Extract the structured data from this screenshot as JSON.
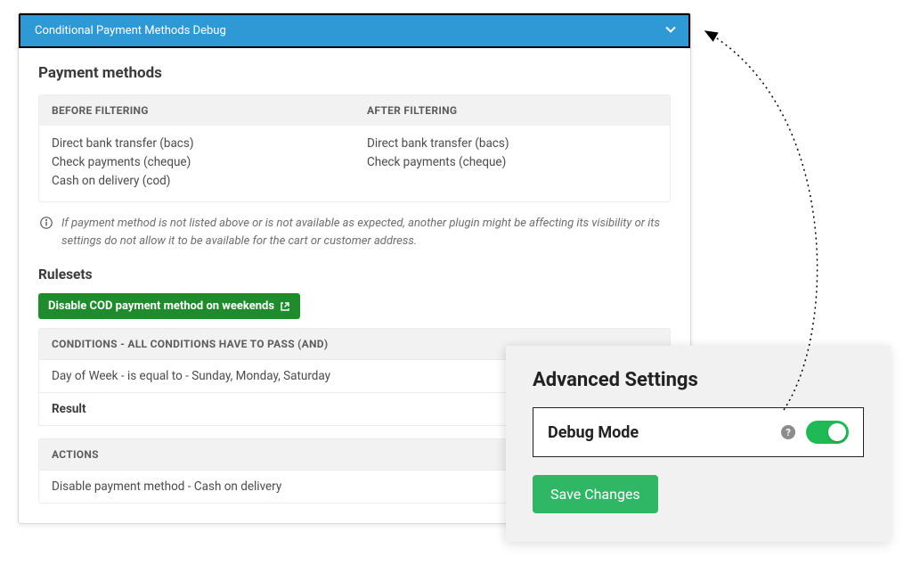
{
  "debug_header": {
    "title": "Conditional Payment Methods Debug"
  },
  "methods": {
    "heading": "Payment methods",
    "before_label": "BEFORE FILTERING",
    "after_label": "AFTER FILTERING",
    "before": [
      "Direct bank transfer (bacs)",
      "Check payments (cheque)",
      "Cash on delivery (cod)"
    ],
    "after": [
      "Direct bank transfer (bacs)",
      "Check payments (cheque)"
    ]
  },
  "info_note": "If payment method is not listed above or is not available as expected, another plugin might be affecting its visibility or its settings do not allow it to be available for the cart or customer address.",
  "rulesets": {
    "heading": "Rulesets",
    "chip_label": "Disable COD payment method on weekends",
    "conditions_header": "CONDITIONS - ALL CONDITIONS HAVE TO PASS (AND)",
    "condition_line": "Day of Week - is equal to - Sunday, Monday, Saturday",
    "result_label": "Result",
    "actions_header": "ACTIONS",
    "action_line": "Disable payment method - Cash on delivery"
  },
  "settings": {
    "title": "Advanced Settings",
    "debug_mode_label": "Debug Mode",
    "help_icon_text": "?",
    "toggle_on": true,
    "save_label": "Save Changes"
  }
}
